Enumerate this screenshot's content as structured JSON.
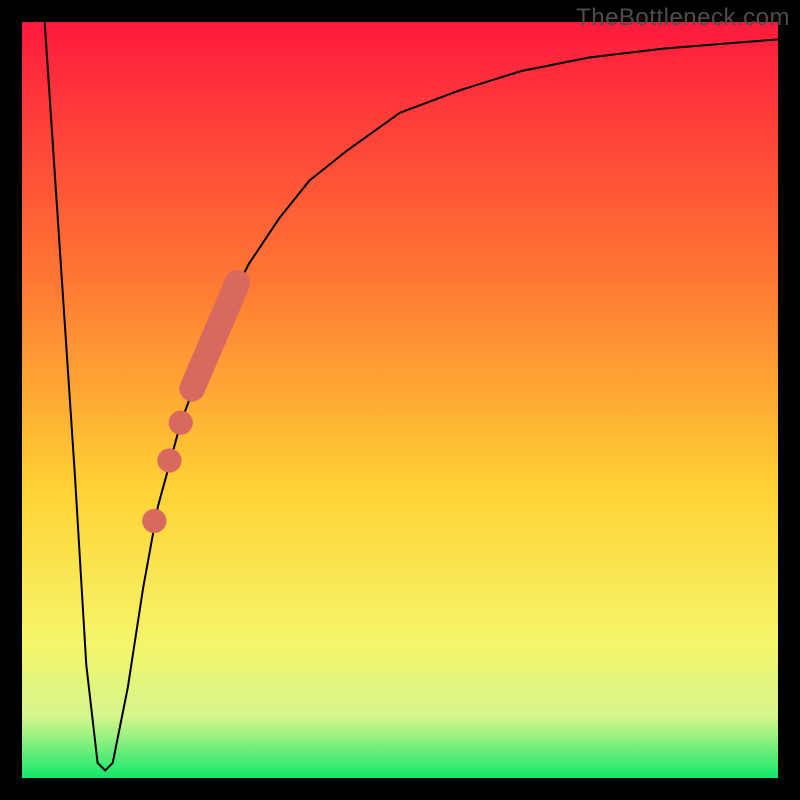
{
  "watermark": "TheBottleneck.com",
  "colors": {
    "top": "#ff1a3d",
    "mid1": "#ff7a33",
    "mid2": "#ffd335",
    "mid3": "#f6f56a",
    "mid4": "#d4f58c",
    "bottom": "#13e86a",
    "line": "#000000",
    "markers": "#d9695f",
    "frame": "#000000"
  },
  "chart_data": {
    "type": "line",
    "title": "",
    "xlabel": "",
    "ylabel": "",
    "xlim": [
      0,
      100
    ],
    "ylim": [
      0,
      100
    ],
    "grid": false,
    "series": [
      {
        "name": "bottleneck-curve",
        "x": [
          3,
          5,
          7,
          8.5,
          10,
          11,
          12,
          14,
          16,
          18,
          21,
          24,
          27,
          30,
          34,
          38,
          43,
          50,
          58,
          66,
          75,
          85,
          95,
          100
        ],
        "y": [
          100,
          70,
          40,
          15,
          2,
          1,
          2,
          12,
          25,
          36,
          47,
          55,
          62,
          68,
          74,
          79,
          83,
          88,
          91,
          93.5,
          95.3,
          96.5,
          97.3,
          97.7
        ]
      }
    ],
    "markers": [
      {
        "name": "segment",
        "shape": "capsule",
        "x1": 22.5,
        "y1": 51.5,
        "x2": 28.5,
        "y2": 65.5,
        "width": 3.4
      },
      {
        "name": "dot1",
        "shape": "circle",
        "x": 21.0,
        "y": 47.0,
        "r": 1.6
      },
      {
        "name": "dot2",
        "shape": "circle",
        "x": 19.5,
        "y": 42.0,
        "r": 1.6
      },
      {
        "name": "dot3",
        "shape": "circle",
        "x": 17.5,
        "y": 34.0,
        "r": 1.6
      }
    ]
  }
}
